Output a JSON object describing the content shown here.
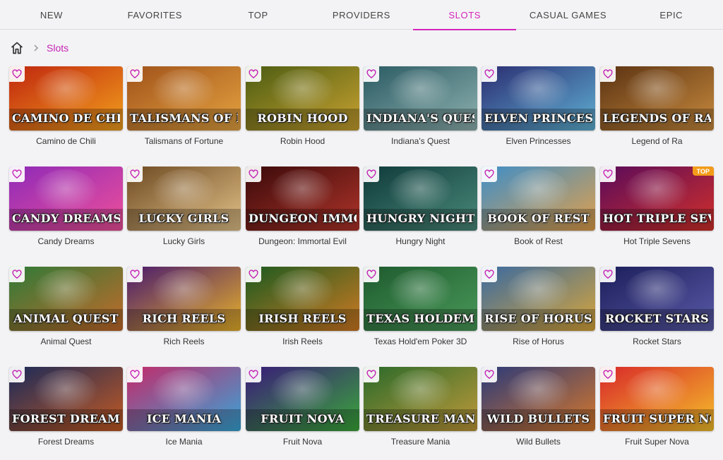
{
  "nav": {
    "tabs": [
      "NEW",
      "FAVORITES",
      "TOP",
      "PROVIDERS",
      "SLOTS",
      "CASUAL GAMES",
      "EPIC"
    ],
    "active": "SLOTS",
    "accent": "#d424b8"
  },
  "breadcrumb": {
    "home_icon": "home-icon",
    "separator_icon": "chevron-right-icon",
    "current": "Slots"
  },
  "games": [
    {
      "title": "Camino de Chili",
      "logo": "CAMINO DE CHILI",
      "colors": [
        "#c0260f",
        "#f2a01c"
      ]
    },
    {
      "title": "Talismans of Fortune",
      "logo": "TALISMANS OF FORTUNE",
      "colors": [
        "#a0521a",
        "#e6a441"
      ]
    },
    {
      "title": "Robin Hood",
      "logo": "ROBIN HOOD",
      "colors": [
        "#4b5c12",
        "#c9a230"
      ]
    },
    {
      "title": "Indiana's Quest",
      "logo": "INDIANA'S QUEST",
      "colors": [
        "#2a5a63",
        "#8fb2b0"
      ]
    },
    {
      "title": "Elven Princesses",
      "logo": "ELVEN PRINCESSES",
      "colors": [
        "#2b2d72",
        "#5fb1d4"
      ]
    },
    {
      "title": "Legend of Ra",
      "logo": "LEGENDS OF RA",
      "colors": [
        "#5a3212",
        "#c98b3e"
      ]
    },
    {
      "title": "Candy Dreams",
      "logo": "CANDY DREAMS",
      "colors": [
        "#8e2ab8",
        "#f0509a"
      ]
    },
    {
      "title": "Lucky Girls",
      "logo": "LUCKY GIRLS",
      "colors": [
        "#6e4a22",
        "#e4c38a"
      ]
    },
    {
      "title": "Dungeon: Immortal Evil",
      "logo": "DUNGEON IMMORTAL EVIL",
      "colors": [
        "#3a0a0a",
        "#b0342a"
      ]
    },
    {
      "title": "Hungry Night",
      "logo": "HUNGRY NIGHT",
      "colors": [
        "#0f3a3a",
        "#4a8a7a"
      ]
    },
    {
      "title": "Book of Rest",
      "logo": "BOOK OF REST",
      "colors": [
        "#3e8ec8",
        "#e2a04a"
      ]
    },
    {
      "title": "Hot Triple Sevens",
      "logo": "HOT TRIPLE SEVENS",
      "colors": [
        "#5a0b5a",
        "#d2302a"
      ],
      "badge": "TOP"
    },
    {
      "title": "Animal Quest",
      "logo": "ANIMAL QUEST",
      "colors": [
        "#2f7a38",
        "#c46a2a"
      ]
    },
    {
      "title": "Rich Reels",
      "logo": "RICH REELS",
      "colors": [
        "#4a1a6e",
        "#e8b22a"
      ]
    },
    {
      "title": "Irish Reels",
      "logo": "IRISH REELS",
      "colors": [
        "#1b5a20",
        "#d07a22"
      ]
    },
    {
      "title": "Texas Hold'em Poker 3D",
      "logo": "TEXAS HOLDEM",
      "colors": [
        "#1e5a2e",
        "#4a9a5a"
      ]
    },
    {
      "title": "Rise of Horus",
      "logo": "RISE OF HORUS",
      "colors": [
        "#3a6aa0",
        "#d9a63a"
      ]
    },
    {
      "title": "Rocket Stars",
      "logo": "ROCKET STARS",
      "colors": [
        "#1b1e5a",
        "#5a5aa8"
      ]
    },
    {
      "title": "Forest Dreams",
      "logo": "FOREST DREAMS",
      "colors": [
        "#1a2a5a",
        "#c45a22"
      ]
    },
    {
      "title": "Ice Mania",
      "logo": "ICE MANIA",
      "colors": [
        "#c42a6a",
        "#36a6d8"
      ]
    },
    {
      "title": "Fruit Nova",
      "logo": "FRUIT NOVA",
      "colors": [
        "#3a1a7a",
        "#3aa83a"
      ]
    },
    {
      "title": "Treasure Mania",
      "logo": "TREASURE MANIA",
      "colors": [
        "#2a6a2a",
        "#c09a3a"
      ]
    },
    {
      "title": "Wild Bullets",
      "logo": "WILD BULLETS",
      "colors": [
        "#2a3a7a",
        "#d8782a"
      ]
    },
    {
      "title": "Fruit Super Nova",
      "logo": "FRUIT SUPER NOVA",
      "colors": [
        "#d8282a",
        "#f5c02a"
      ]
    }
  ],
  "favorite_icon": "heart-outline-icon",
  "favorite_color": "#c424b4"
}
